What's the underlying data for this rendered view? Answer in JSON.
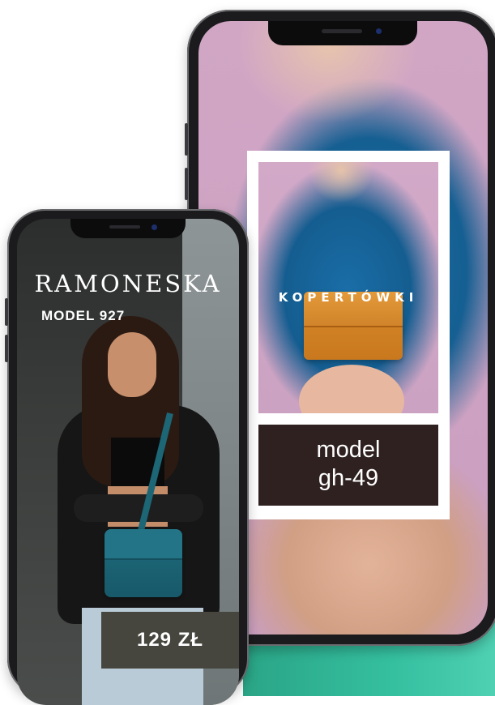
{
  "right_phone": {
    "category_label": "KOPERTÓWKI",
    "model_line1": "model",
    "model_line2": "gh-49",
    "icon": "phone-notch-icon"
  },
  "left_phone": {
    "title": "RAMONESKA",
    "subtitle": "MODEL 927",
    "price": "129 ZŁ",
    "icon": "phone-notch-icon"
  },
  "colors": {
    "accent_teal": "#35c0a0",
    "pink_background": "#d1a6c5",
    "model_box": "#2f2120",
    "price_box": "#46463f",
    "bag_orange": "#d98b2b",
    "bag_teal": "#1f6b7c"
  }
}
